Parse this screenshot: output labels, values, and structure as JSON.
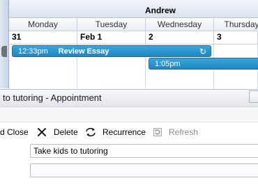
{
  "calendar": {
    "resource": "Andrew",
    "days": [
      {
        "weekday": "Monday",
        "date": "31"
      },
      {
        "weekday": "Tuesday",
        "date": "Feb 1"
      },
      {
        "weekday": "Wednesday",
        "date": "2"
      },
      {
        "weekday": "Thursday",
        "date": "3"
      }
    ],
    "appointments": [
      {
        "time": "12:33pm",
        "title": "Review Essay",
        "recurring_icon": "recurrence-icon"
      },
      {
        "time": "1:05pm",
        "title": ""
      }
    ]
  },
  "window": {
    "title": "to tutoring - Appointment"
  },
  "toolbar": {
    "save_close_label": "d Close",
    "delete_label": "Delete",
    "delete_icon": "delete-x-icon",
    "recurrence_label": "Recurrence",
    "recurrence_icon": "recurrence-icon",
    "refresh_label": "Refresh",
    "refresh_icon": "refresh-icon"
  },
  "form": {
    "subject_value": "Take kids to tutoring",
    "location_value": ""
  },
  "colors": {
    "appointment": "#1e86c1",
    "header": "#d9e2ee"
  }
}
